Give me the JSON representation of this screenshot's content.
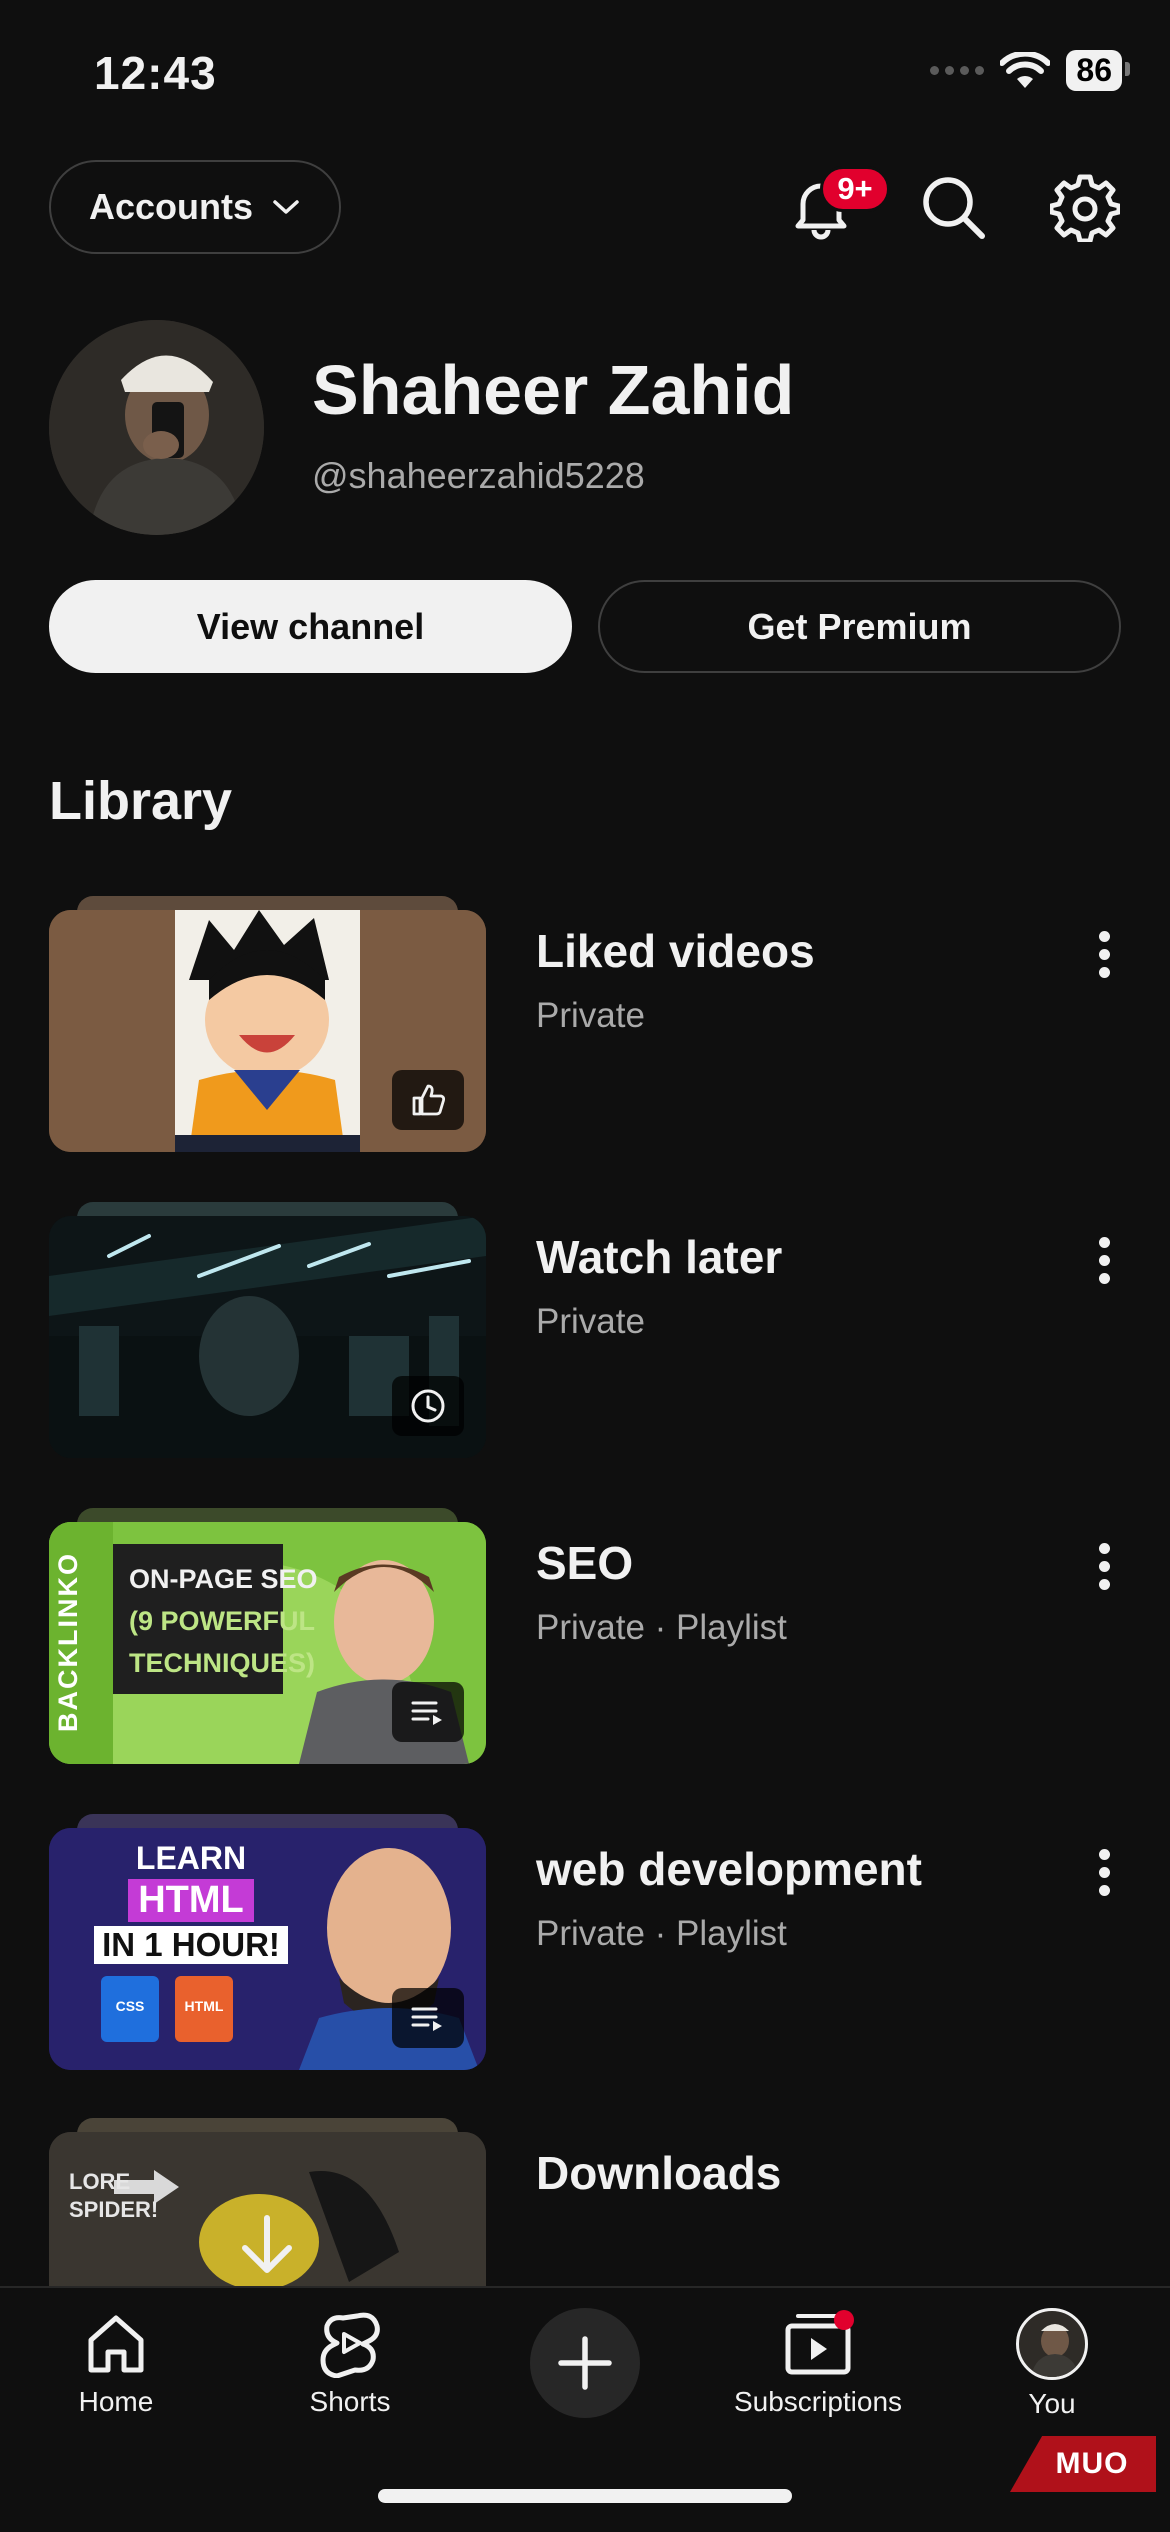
{
  "status_bar": {
    "time": "12:43",
    "battery": "86"
  },
  "header": {
    "accounts_label": "Accounts",
    "notifications_badge": "9+",
    "icons": [
      "bell-icon",
      "search-icon",
      "gear-icon"
    ]
  },
  "profile": {
    "name": "Shaheer Zahid",
    "handle": "@shaheerzahid5228",
    "view_channel_label": "View channel",
    "get_premium_label": "Get Premium"
  },
  "library": {
    "title": "Library",
    "items": [
      {
        "title": "Liked videos",
        "subtitle": "Private",
        "icon": "thumbs-up-icon"
      },
      {
        "title": "Watch later",
        "subtitle": "Private",
        "icon": "clock-icon"
      },
      {
        "title": "SEO",
        "subtitle": "Private · Playlist",
        "icon": "playlist-icon",
        "thumb_text": [
          "BACKLINKO",
          "ON-PAGE SEO",
          "(9 POWERFUL",
          "TECHNIQUES)"
        ]
      },
      {
        "title": "web development",
        "subtitle": "Private · Playlist",
        "icon": "playlist-icon",
        "thumb_text": [
          "LEARN",
          "HTML",
          "IN 1 HOUR!",
          "CSS",
          "HTML"
        ]
      },
      {
        "title": "Downloads",
        "subtitle": "",
        "icon": "download-icon",
        "thumb_text": [
          "LORE",
          "SPIDER!"
        ]
      }
    ]
  },
  "bottom_nav": {
    "home": "Home",
    "shorts": "Shorts",
    "subscriptions": "Subscriptions",
    "you": "You"
  },
  "watermark": "MUO",
  "colors": {
    "background": "#0f0f0f",
    "badge": "#e1002d",
    "text_secondary": "#aaaaaa"
  }
}
